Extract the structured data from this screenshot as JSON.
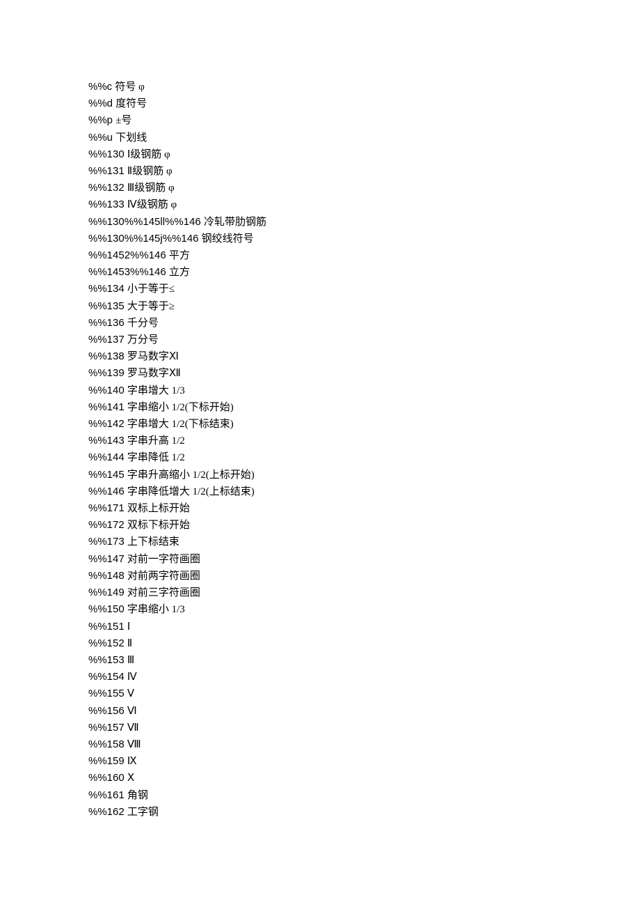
{
  "lines": [
    {
      "code": "%%c",
      "desc": "符号 φ"
    },
    {
      "code": "%%d",
      "desc": "度符号"
    },
    {
      "code": "%%p",
      "desc": "±号"
    },
    {
      "code": "%%u",
      "desc": "下划线"
    },
    {
      "code": "%%130",
      "desc": "Ⅰ级钢筋 φ"
    },
    {
      "code": "%%131",
      "desc": "Ⅱ级钢筋 φ"
    },
    {
      "code": "%%132",
      "desc": "Ⅲ级钢筋 φ"
    },
    {
      "code": "%%133",
      "desc": "Ⅳ级钢筋 φ"
    },
    {
      "code": "%%130%%145ll%%146",
      "desc": "冷轧带肋钢筋"
    },
    {
      "code": "%%130%%145j%%146",
      "desc": "钢绞线符号"
    },
    {
      "code": "%%1452%%146",
      "desc": "平方"
    },
    {
      "code": "%%1453%%146",
      "desc": "立方"
    },
    {
      "code": "%%134",
      "desc": "小于等于≤"
    },
    {
      "code": "%%135",
      "desc": "大于等于≥"
    },
    {
      "code": "%%136",
      "desc": "千分号"
    },
    {
      "code": "%%137",
      "desc": "万分号"
    },
    {
      "code": "%%138",
      "desc": "罗马数字Ⅺ"
    },
    {
      "code": "%%139",
      "desc": "罗马数字Ⅻ"
    },
    {
      "code": "%%140",
      "desc": "字串增大 1/3"
    },
    {
      "code": "%%141",
      "desc": "字串缩小 1/2(下标开始)"
    },
    {
      "code": "%%142",
      "desc": "字串增大 1/2(下标结束)"
    },
    {
      "code": "%%143",
      "desc": "字串升高 1/2"
    },
    {
      "code": "%%144",
      "desc": "字串降低 1/2"
    },
    {
      "code": "%%145",
      "desc": "字串升高缩小 1/2(上标开始)"
    },
    {
      "code": "%%146",
      "desc": "字串降低增大 1/2(上标结束)"
    },
    {
      "code": "%%171",
      "desc": "双标上标开始"
    },
    {
      "code": "%%172",
      "desc": "双标下标开始"
    },
    {
      "code": "%%173",
      "desc": "上下标结束"
    },
    {
      "code": "%%147",
      "desc": "对前一字符画圈"
    },
    {
      "code": "%%148",
      "desc": "对前两字符画圈"
    },
    {
      "code": "%%149",
      "desc": "对前三字符画圈"
    },
    {
      "code": "%%150",
      "desc": "字串缩小 1/3"
    },
    {
      "code": "%%151",
      "desc": "Ⅰ"
    },
    {
      "code": "%%152",
      "desc": "Ⅱ"
    },
    {
      "code": "%%153",
      "desc": "Ⅲ"
    },
    {
      "code": "%%154",
      "desc": "Ⅳ"
    },
    {
      "code": "%%155",
      "desc": "Ⅴ"
    },
    {
      "code": "%%156",
      "desc": "Ⅵ"
    },
    {
      "code": "%%157",
      "desc": "Ⅶ"
    },
    {
      "code": "%%158",
      "desc": "Ⅷ"
    },
    {
      "code": "%%159",
      "desc": "Ⅸ"
    },
    {
      "code": "%%160",
      "desc": "Ⅹ"
    },
    {
      "code": "%%161",
      "desc": "角钢"
    },
    {
      "code": "%%162",
      "desc": "工字钢"
    }
  ]
}
